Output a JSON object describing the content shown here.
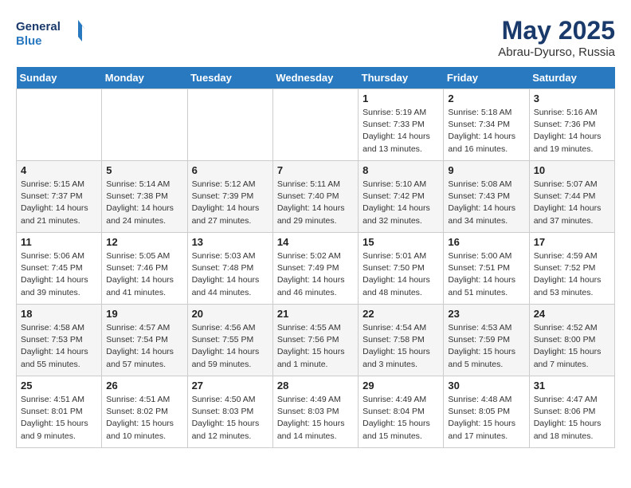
{
  "header": {
    "logo_line1": "General",
    "logo_line2": "Blue",
    "month": "May 2025",
    "location": "Abrau-Dyurso, Russia"
  },
  "weekdays": [
    "Sunday",
    "Monday",
    "Tuesday",
    "Wednesday",
    "Thursday",
    "Friday",
    "Saturday"
  ],
  "weeks": [
    [
      {
        "day": "",
        "info": ""
      },
      {
        "day": "",
        "info": ""
      },
      {
        "day": "",
        "info": ""
      },
      {
        "day": "",
        "info": ""
      },
      {
        "day": "1",
        "info": "Sunrise: 5:19 AM\nSunset: 7:33 PM\nDaylight: 14 hours\nand 13 minutes."
      },
      {
        "day": "2",
        "info": "Sunrise: 5:18 AM\nSunset: 7:34 PM\nDaylight: 14 hours\nand 16 minutes."
      },
      {
        "day": "3",
        "info": "Sunrise: 5:16 AM\nSunset: 7:36 PM\nDaylight: 14 hours\nand 19 minutes."
      }
    ],
    [
      {
        "day": "4",
        "info": "Sunrise: 5:15 AM\nSunset: 7:37 PM\nDaylight: 14 hours\nand 21 minutes."
      },
      {
        "day": "5",
        "info": "Sunrise: 5:14 AM\nSunset: 7:38 PM\nDaylight: 14 hours\nand 24 minutes."
      },
      {
        "day": "6",
        "info": "Sunrise: 5:12 AM\nSunset: 7:39 PM\nDaylight: 14 hours\nand 27 minutes."
      },
      {
        "day": "7",
        "info": "Sunrise: 5:11 AM\nSunset: 7:40 PM\nDaylight: 14 hours\nand 29 minutes."
      },
      {
        "day": "8",
        "info": "Sunrise: 5:10 AM\nSunset: 7:42 PM\nDaylight: 14 hours\nand 32 minutes."
      },
      {
        "day": "9",
        "info": "Sunrise: 5:08 AM\nSunset: 7:43 PM\nDaylight: 14 hours\nand 34 minutes."
      },
      {
        "day": "10",
        "info": "Sunrise: 5:07 AM\nSunset: 7:44 PM\nDaylight: 14 hours\nand 37 minutes."
      }
    ],
    [
      {
        "day": "11",
        "info": "Sunrise: 5:06 AM\nSunset: 7:45 PM\nDaylight: 14 hours\nand 39 minutes."
      },
      {
        "day": "12",
        "info": "Sunrise: 5:05 AM\nSunset: 7:46 PM\nDaylight: 14 hours\nand 41 minutes."
      },
      {
        "day": "13",
        "info": "Sunrise: 5:03 AM\nSunset: 7:48 PM\nDaylight: 14 hours\nand 44 minutes."
      },
      {
        "day": "14",
        "info": "Sunrise: 5:02 AM\nSunset: 7:49 PM\nDaylight: 14 hours\nand 46 minutes."
      },
      {
        "day": "15",
        "info": "Sunrise: 5:01 AM\nSunset: 7:50 PM\nDaylight: 14 hours\nand 48 minutes."
      },
      {
        "day": "16",
        "info": "Sunrise: 5:00 AM\nSunset: 7:51 PM\nDaylight: 14 hours\nand 51 minutes."
      },
      {
        "day": "17",
        "info": "Sunrise: 4:59 AM\nSunset: 7:52 PM\nDaylight: 14 hours\nand 53 minutes."
      }
    ],
    [
      {
        "day": "18",
        "info": "Sunrise: 4:58 AM\nSunset: 7:53 PM\nDaylight: 14 hours\nand 55 minutes."
      },
      {
        "day": "19",
        "info": "Sunrise: 4:57 AM\nSunset: 7:54 PM\nDaylight: 14 hours\nand 57 minutes."
      },
      {
        "day": "20",
        "info": "Sunrise: 4:56 AM\nSunset: 7:55 PM\nDaylight: 14 hours\nand 59 minutes."
      },
      {
        "day": "21",
        "info": "Sunrise: 4:55 AM\nSunset: 7:56 PM\nDaylight: 15 hours\nand 1 minute."
      },
      {
        "day": "22",
        "info": "Sunrise: 4:54 AM\nSunset: 7:58 PM\nDaylight: 15 hours\nand 3 minutes."
      },
      {
        "day": "23",
        "info": "Sunrise: 4:53 AM\nSunset: 7:59 PM\nDaylight: 15 hours\nand 5 minutes."
      },
      {
        "day": "24",
        "info": "Sunrise: 4:52 AM\nSunset: 8:00 PM\nDaylight: 15 hours\nand 7 minutes."
      }
    ],
    [
      {
        "day": "25",
        "info": "Sunrise: 4:51 AM\nSunset: 8:01 PM\nDaylight: 15 hours\nand 9 minutes."
      },
      {
        "day": "26",
        "info": "Sunrise: 4:51 AM\nSunset: 8:02 PM\nDaylight: 15 hours\nand 10 minutes."
      },
      {
        "day": "27",
        "info": "Sunrise: 4:50 AM\nSunset: 8:03 PM\nDaylight: 15 hours\nand 12 minutes."
      },
      {
        "day": "28",
        "info": "Sunrise: 4:49 AM\nSunset: 8:03 PM\nDaylight: 15 hours\nand 14 minutes."
      },
      {
        "day": "29",
        "info": "Sunrise: 4:49 AM\nSunset: 8:04 PM\nDaylight: 15 hours\nand 15 minutes."
      },
      {
        "day": "30",
        "info": "Sunrise: 4:48 AM\nSunset: 8:05 PM\nDaylight: 15 hours\nand 17 minutes."
      },
      {
        "day": "31",
        "info": "Sunrise: 4:47 AM\nSunset: 8:06 PM\nDaylight: 15 hours\nand 18 minutes."
      }
    ]
  ]
}
